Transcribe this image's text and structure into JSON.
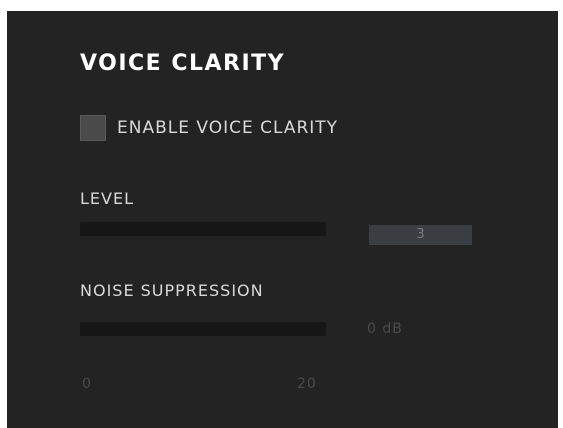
{
  "panel": {
    "title": "VOICE CLARITY",
    "background": "#232323"
  },
  "enable": {
    "label": "ENABLE VOICE CLARITY",
    "checked": false
  },
  "level": {
    "label": "LEVEL",
    "value": "3"
  },
  "noise_suppression": {
    "label": "NOISE SUPPRESSION",
    "value": "0 dB",
    "range_min": "0",
    "range_max": "20"
  }
}
